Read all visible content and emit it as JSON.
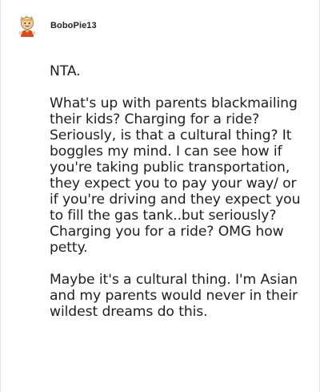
{
  "comment": {
    "author": {
      "username": "BoboPie13",
      "avatar_icon": "cartoon-avatar-icon"
    },
    "paragraphs": [
      "NTA.",
      "What's up with parents blackmailing their kids? Charging for a ride? Seriously, is that a cultural thing? It boggles my mind. I can see how if you're taking public transportation, they expect you to pay your way/ or if you're driving and they expect you to fill the gas tank..but seriously? Charging you for a ride? OMG how petty.",
      "Maybe it's a cultural thing. I'm Asian and my parents would never in their wildest dreams do this."
    ]
  },
  "colors": {
    "background": "#ffffff",
    "text": "#1f1f1f",
    "card_border": "#e6e6e6"
  }
}
